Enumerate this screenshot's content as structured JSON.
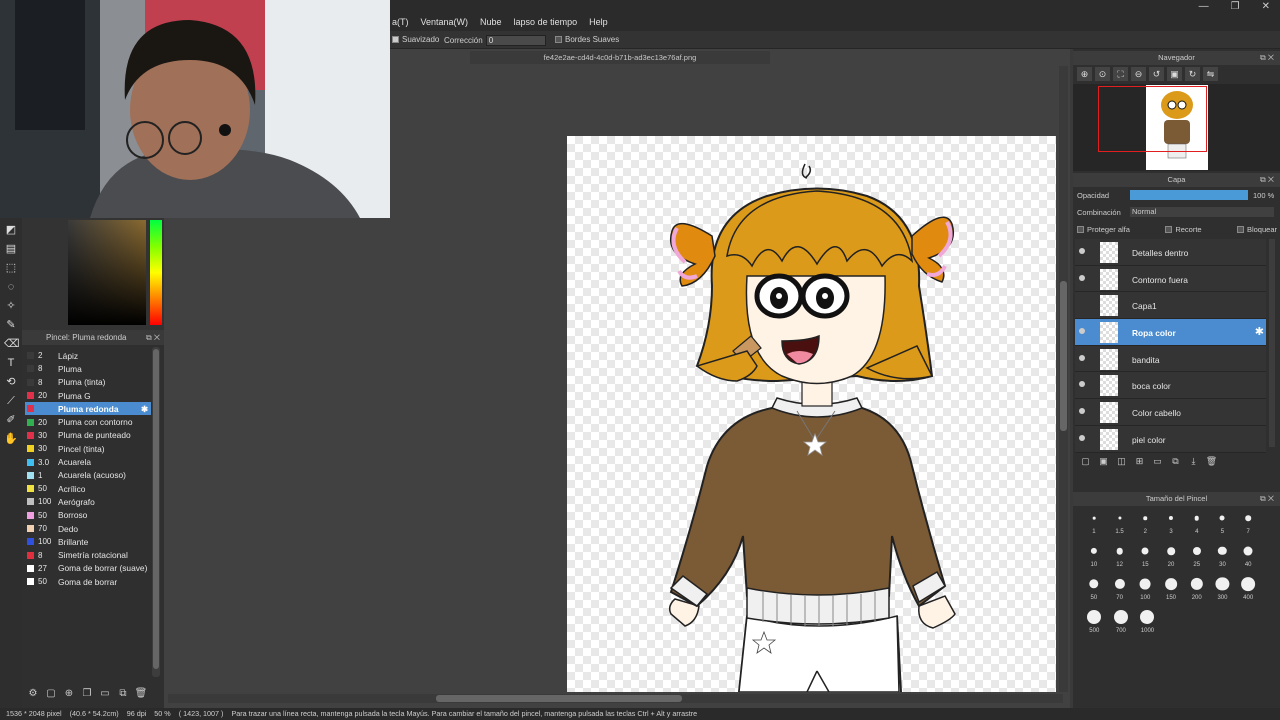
{
  "window": {
    "min": "—",
    "restore": "❐",
    "close": "✕"
  },
  "menu": [
    "a(T)",
    "Ventana(W)",
    "Nube",
    "lapso de tiempo",
    "Help"
  ],
  "options": {
    "suavizado": "Suavizado",
    "correccion_label": "Corrección",
    "correccion_value": "0",
    "bordes": "Bordes Suaves"
  },
  "document": {
    "tab": "fe42e2ae-cd4d-4c0d-b71b-ad3ec13e76af.png"
  },
  "brush_panel": {
    "title": "Pincel: Pluma redonda",
    "items": [
      {
        "size": "2",
        "name": "Lápiz",
        "color": "#3a3a3a"
      },
      {
        "size": "8",
        "name": "Pluma",
        "color": "#3a3a3a"
      },
      {
        "size": "8",
        "name": "Pluma (tinta)",
        "color": "#3a3a3a"
      },
      {
        "size": "20",
        "name": "Pluma G",
        "color": "#e0304a"
      },
      {
        "size": "",
        "name": "Pluma redonda",
        "color": "#e0304a",
        "selected": true
      },
      {
        "size": "20",
        "name": "Pluma con contorno",
        "color": "#30b050"
      },
      {
        "size": "30",
        "name": "Pluma de punteado",
        "color": "#e0304a"
      },
      {
        "size": "30",
        "name": "Pincel (tinta)",
        "color": "#f0d020"
      },
      {
        "size": "3.0",
        "name": "Acuarela",
        "color": "#40c0f0"
      },
      {
        "size": "1",
        "name": "Acuarela (acuoso)",
        "color": "#a0e0f0"
      },
      {
        "size": "50",
        "name": "Acrílico",
        "color": "#f0e040"
      },
      {
        "size": "100",
        "name": "Aerógrafo",
        "color": "#c0c0c0"
      },
      {
        "size": "50",
        "name": "Borroso",
        "color": "#f0a0e0"
      },
      {
        "size": "70",
        "name": "Dedo",
        "color": "#f0d0b0"
      },
      {
        "size": "100",
        "name": "Brillante",
        "color": "#3050e0"
      },
      {
        "size": "8",
        "name": "Simetría rotacional",
        "color": "#e03040"
      },
      {
        "size": "27",
        "name": "Goma de borrar (suave)",
        "color": "#ffffff"
      },
      {
        "size": "50",
        "name": "Goma de borrar",
        "color": "#ffffff"
      }
    ]
  },
  "navigator": {
    "title": "Navegador"
  },
  "layer_panel": {
    "title": "Capa",
    "opacity_label": "Opacidad",
    "opacity_value": "100 %",
    "opacity": 1.0,
    "blend_label": "Combinación",
    "blend_value": "Normal",
    "protect_alpha": "Proteger alfa",
    "clipping": "Recorte",
    "lock": "Bloquear",
    "layers": [
      {
        "name": "Detalles dentro",
        "visible": true
      },
      {
        "name": "Contorno fuera",
        "visible": true
      },
      {
        "name": "Capa1",
        "visible": false
      },
      {
        "name": "Ropa color",
        "visible": true,
        "selected": true
      },
      {
        "name": "bandita",
        "visible": true
      },
      {
        "name": "boca color",
        "visible": true
      },
      {
        "name": "Color cabello",
        "visible": true
      },
      {
        "name": "piel color",
        "visible": true
      }
    ]
  },
  "brush_size": {
    "title": "Tamaño del Pincel",
    "rows": [
      [
        "1",
        "1.5",
        "2",
        "3",
        "4",
        "5",
        "7"
      ],
      [
        "10",
        "12",
        "15",
        "20",
        "25",
        "30",
        "40"
      ],
      [
        "50",
        "70",
        "100",
        "150",
        "200",
        "300",
        "400"
      ],
      [
        "500",
        "700",
        "1000"
      ]
    ]
  },
  "status": {
    "dims": "1536 * 2048 pixel",
    "cm": "(40.6 * 54.2cm)",
    "dpi": "96 dpi",
    "zoom": "50 %",
    "cursor": "( 1423, 1007 )",
    "hint": "Para trazar una línea recta, mantenga pulsada la tecla Mayús. Para cambiar el tamaño del pincel, mantenga pulsada las teclas Ctrl + Alt y arrastre"
  }
}
